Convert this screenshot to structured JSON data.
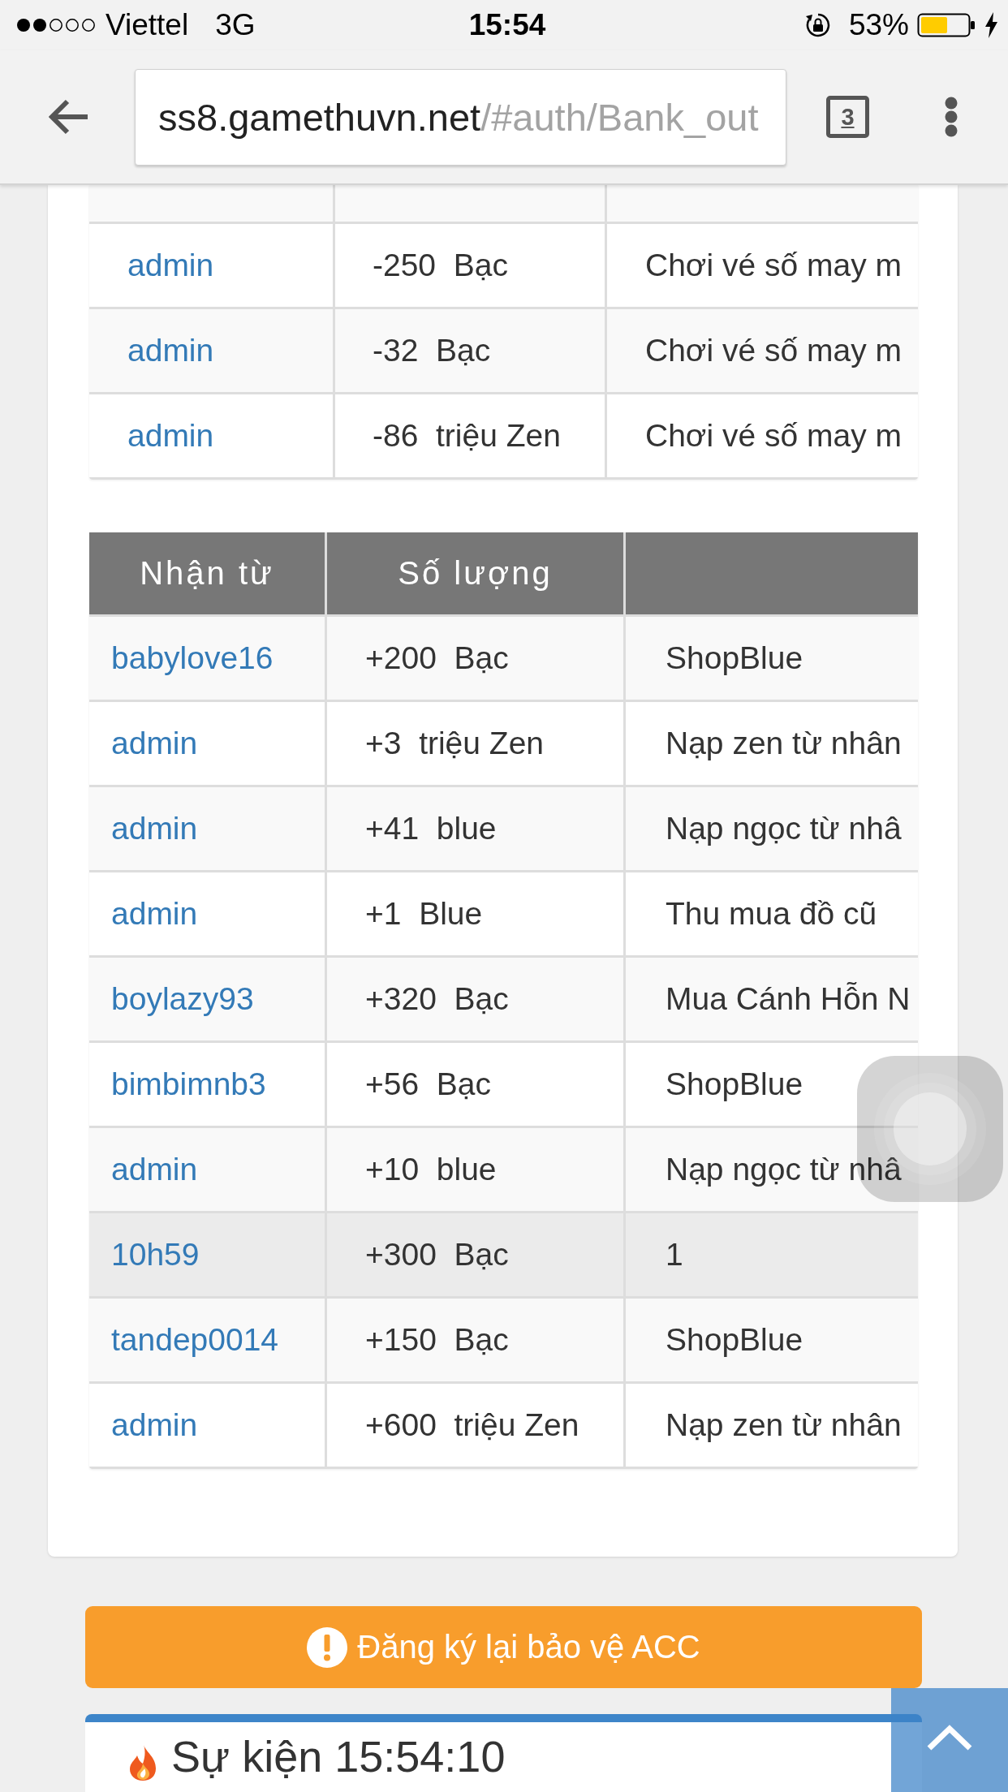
{
  "status_bar": {
    "carrier": "Viettel",
    "network": "3G",
    "time": "15:54",
    "battery": "53%"
  },
  "toolbar": {
    "url_host": "ss8.gamethuvn.net",
    "url_path": "/#auth/Bank_out",
    "tab_count": "3"
  },
  "sent_table": {
    "rows": [
      {
        "user": "admin",
        "amount": "-250  Bạc",
        "note": "Chơi vé số may m"
      },
      {
        "user": "admin",
        "amount": "-32  Bạc",
        "note": "Chơi vé số may m"
      },
      {
        "user": "admin",
        "amount": "-86  triệu Zen",
        "note": "Chơi vé số may m"
      }
    ]
  },
  "received_table": {
    "columns": [
      "Nhận từ",
      "Số lượng"
    ],
    "rows": [
      {
        "user": "babylove16",
        "amount": "+200  Bạc",
        "note": "ShopBlue",
        "hovered": false
      },
      {
        "user": "admin",
        "amount": "+3  triệu Zen",
        "note": "Nạp zen từ nhân",
        "hovered": false
      },
      {
        "user": "admin",
        "amount": "+41  blue",
        "note": "Nạp ngọc từ nhâ",
        "hovered": false
      },
      {
        "user": "admin",
        "amount": "+1  Blue",
        "note": "Thu mua đồ cũ",
        "hovered": false
      },
      {
        "user": "boylazy93",
        "amount": "+320  Bạc",
        "note": "Mua Cánh Hỗn N",
        "hovered": false
      },
      {
        "user": "bimbimnb3",
        "amount": "+56  Bạc",
        "note": "ShopBlue",
        "hovered": false
      },
      {
        "user": "admin",
        "amount": "+10  blue",
        "note": "Nạp ngọc từ nhâ",
        "hovered": false
      },
      {
        "user": "10h59",
        "amount": "+300  Bạc",
        "note": "1",
        "hovered": true
      },
      {
        "user": "tandep0014",
        "amount": "+150  Bạc",
        "note": "ShopBlue",
        "hovered": false
      },
      {
        "user": "admin",
        "amount": "+600  triệu Zen",
        "note": "Nạp zen từ nhân",
        "hovered": false
      }
    ]
  },
  "alert_button": {
    "label": "Đăng ký lại bảo vệ ACC"
  },
  "events_panel": {
    "title": "Sự kiện 15:54:10"
  }
}
